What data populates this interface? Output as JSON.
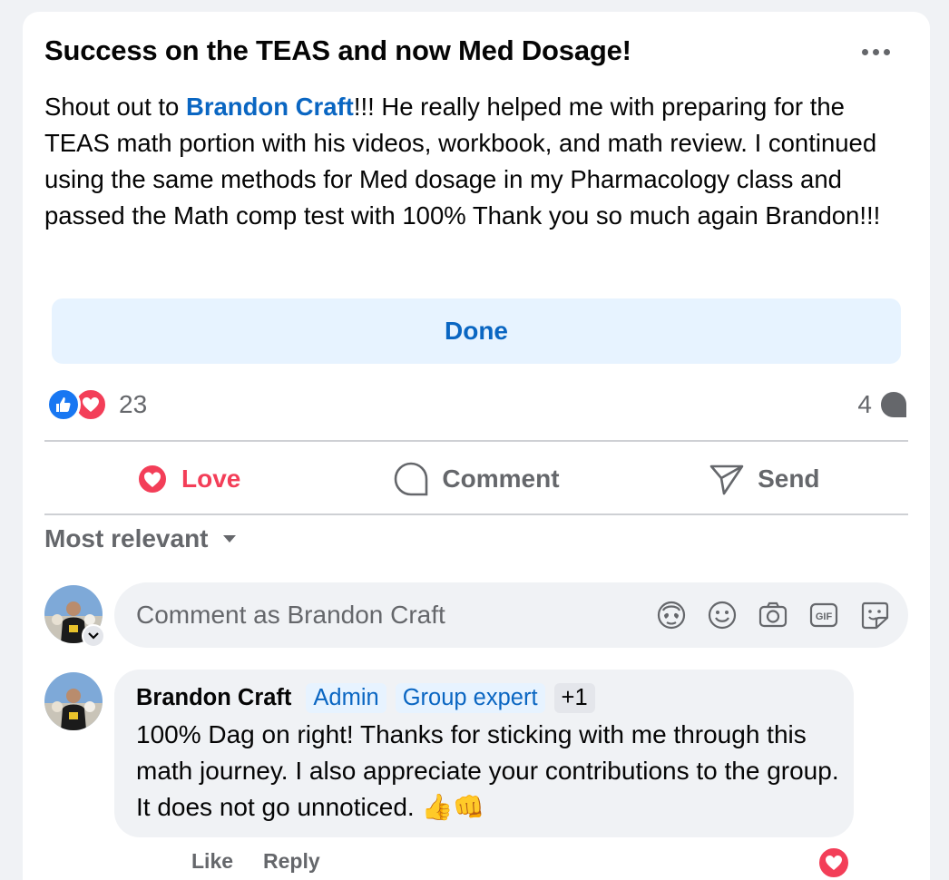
{
  "post": {
    "title": "Success on the TEAS and now Med Dosage!",
    "body_prefix": "Shout out to ",
    "mention": "Brandon Craft",
    "body_suffix": "!!! He really helped me with preparing for the TEAS math portion with his videos, workbook, and math review. I continued using the same methods for Med dosage in my Pharmacology class and passed the Math comp test with 100% Thank you so much again Brandon!!!",
    "done_label": "Done",
    "reaction_count": "23",
    "comment_count": "4"
  },
  "actions": {
    "love": "Love",
    "comment": "Comment",
    "send": "Send"
  },
  "sort": {
    "label": "Most relevant"
  },
  "composer": {
    "placeholder": "Comment as Brandon Craft",
    "icons": [
      "avatar-sticker-icon",
      "emoji-icon",
      "camera-icon",
      "gif-icon",
      "sticker-icon"
    ]
  },
  "comment": {
    "author": "Brandon Craft",
    "badges": [
      "Admin",
      "Group expert"
    ],
    "extra_badges": "+1",
    "text": "100% Dag on right! Thanks for sticking with me through this math journey. I also appreciate your contributions to the group. It does not go unnoticed. 👍👊",
    "like_label": "Like",
    "reply_label": "Reply"
  },
  "colors": {
    "accent": "#0a66c2",
    "love": "#f33e58",
    "like": "#1877f2",
    "muted": "#65676b"
  }
}
